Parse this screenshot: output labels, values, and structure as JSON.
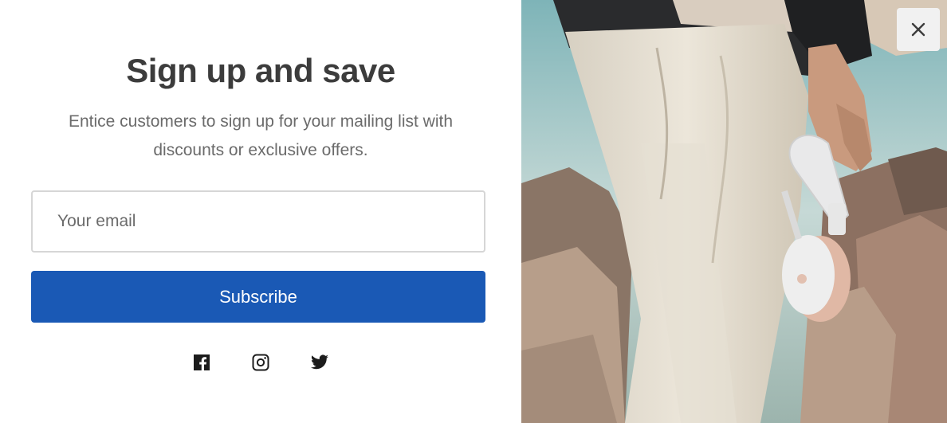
{
  "popup": {
    "title": "Sign up and save",
    "description": "Entice customers to sign up for your mailing list with discounts or exclusive offers.",
    "email_placeholder": "Your email",
    "email_value": "",
    "subscribe_label": "Subscribe",
    "close_icon": "close-icon"
  },
  "social": [
    {
      "icon": "facebook-icon"
    },
    {
      "icon": "instagram-icon"
    },
    {
      "icon": "twitter-icon"
    }
  ],
  "colors": {
    "accent": "#1a59b5",
    "title": "#3c3c3c",
    "body_text": "#6b6b6b",
    "input_border": "#d6d6d6",
    "close_bg": "#f1f1f1"
  }
}
